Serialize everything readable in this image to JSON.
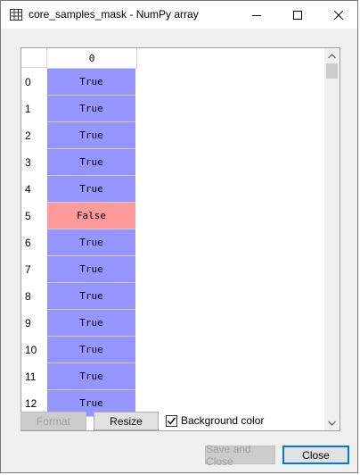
{
  "window": {
    "title": "core_samples_mask - NumPy array"
  },
  "table": {
    "column_header": "0",
    "rows": [
      {
        "index": "0",
        "value": "True",
        "state": "true"
      },
      {
        "index": "1",
        "value": "True",
        "state": "true"
      },
      {
        "index": "2",
        "value": "True",
        "state": "true"
      },
      {
        "index": "3",
        "value": "True",
        "state": "true"
      },
      {
        "index": "4",
        "value": "True",
        "state": "true"
      },
      {
        "index": "5",
        "value": "False",
        "state": "false"
      },
      {
        "index": "6",
        "value": "True",
        "state": "true"
      },
      {
        "index": "7",
        "value": "True",
        "state": "true"
      },
      {
        "index": "8",
        "value": "True",
        "state": "true"
      },
      {
        "index": "9",
        "value": "True",
        "state": "true"
      },
      {
        "index": "10",
        "value": "True",
        "state": "true"
      },
      {
        "index": "11",
        "value": "True",
        "state": "true"
      },
      {
        "index": "12",
        "value": "True",
        "state": "true"
      }
    ]
  },
  "controls": {
    "format_label": "Format",
    "resize_label": "Resize",
    "background_color_label": "Background color",
    "background_color_checked": true,
    "save_close_label": "Save and Close",
    "close_label": "Close"
  },
  "colors": {
    "true_cell": "#9595ff",
    "false_cell": "#ff9a9a",
    "focus_border": "#0078d7"
  }
}
